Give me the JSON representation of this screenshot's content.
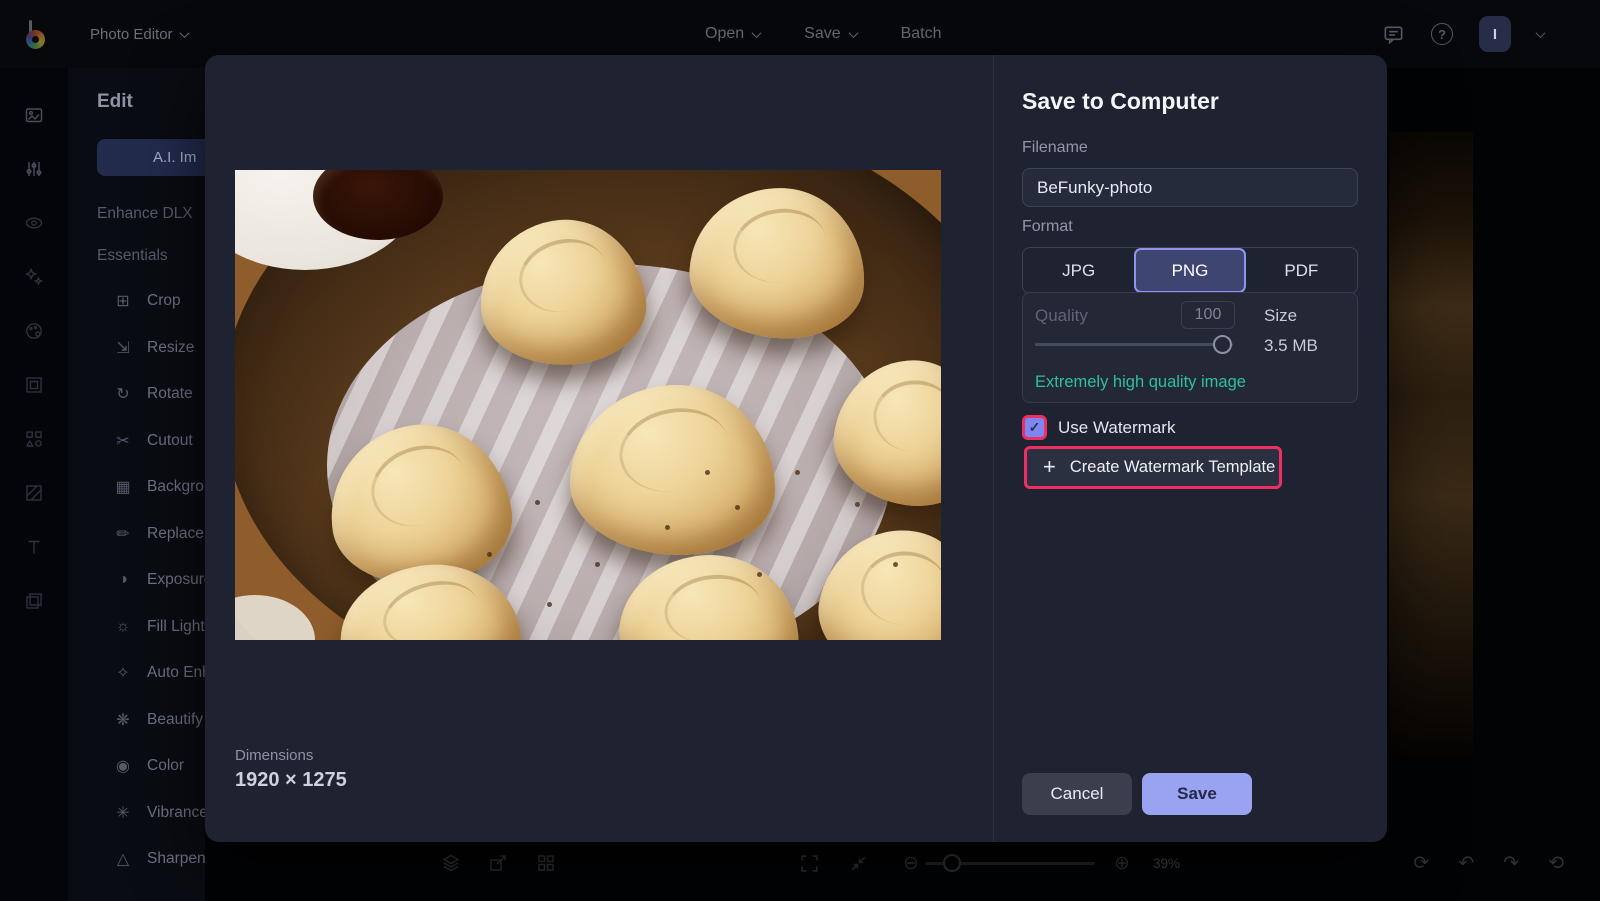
{
  "topbar": {
    "app_menu_label": "Photo Editor",
    "menus": [
      {
        "label": "Open",
        "chevron": true
      },
      {
        "label": "Save",
        "chevron": true
      },
      {
        "label": "Batch",
        "chevron": false
      }
    ],
    "avatar_initial": "I"
  },
  "sidebar": {
    "rail_icons": [
      "photo",
      "adjustments",
      "eye",
      "sparkles",
      "palette",
      "frame",
      "shapes",
      "texture",
      "text",
      "layers"
    ],
    "panel_title": "Edit",
    "ai_button_label": "A.I. Im",
    "section_links": [
      "Enhance DLX",
      "Essentials"
    ],
    "tools": [
      {
        "icon": "crop",
        "label": "Crop"
      },
      {
        "icon": "resize",
        "label": "Resize"
      },
      {
        "icon": "rotate",
        "label": "Rotate"
      },
      {
        "icon": "cutout",
        "label": "Cutout"
      },
      {
        "icon": "background",
        "label": "Background"
      },
      {
        "icon": "replace",
        "label": "Replace"
      },
      {
        "icon": "exposure",
        "label": "Exposure"
      },
      {
        "icon": "fill-light",
        "label": "Fill Light"
      },
      {
        "icon": "auto-enhance",
        "label": "Auto Enhance"
      },
      {
        "icon": "beautify",
        "label": "Beautify"
      },
      {
        "icon": "color",
        "label": "Color"
      },
      {
        "icon": "vibrance",
        "label": "Vibrance"
      },
      {
        "icon": "sharpen",
        "label": "Sharpen"
      }
    ]
  },
  "dialog": {
    "title": "Save to Computer",
    "filename_label": "Filename",
    "filename_value": "BeFunky-photo",
    "format_label": "Format",
    "format_options": [
      "JPG",
      "PNG",
      "PDF"
    ],
    "format_selected": "PNG",
    "quality_label": "Quality",
    "quality_value": "100",
    "size_label": "Size",
    "size_value": "3.5 MB",
    "quality_note": "Extremely high quality image",
    "watermark_checkbox_label": "Use Watermark",
    "watermark_checked": true,
    "create_watermark_label": "Create Watermark Template",
    "dimensions_label": "Dimensions",
    "dimensions_value": "1920 × 1275",
    "cancel_label": "Cancel",
    "save_label": "Save"
  },
  "statusbar": {
    "zoom_value": "39%"
  },
  "colors": {
    "accent_purple": "#99a3f2",
    "selected_format_border": "#8d96ec",
    "highlight_pink": "#ee2f63",
    "quality_note_teal": "#2fc09c"
  }
}
